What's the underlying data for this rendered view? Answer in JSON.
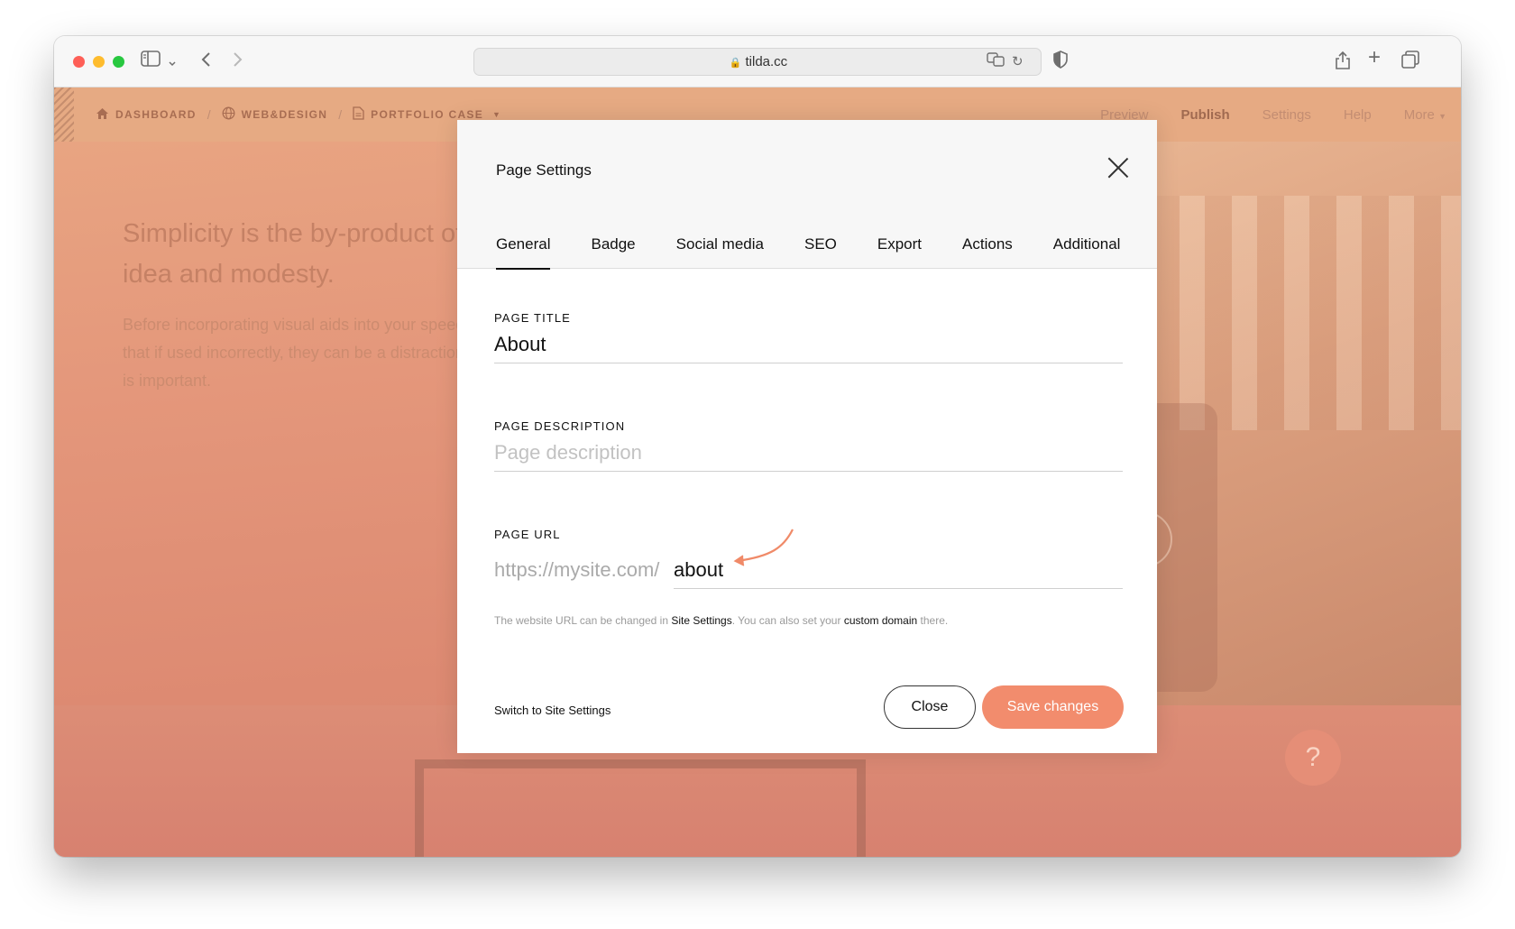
{
  "browser": {
    "url": "tilda.cc"
  },
  "editor": {
    "breadcrumbs": [
      {
        "label": "DASHBOARD",
        "icon": "home-icon"
      },
      {
        "label": "WEB&DESIGN",
        "icon": "globe-icon"
      },
      {
        "label": "PORTFOLIO CASE",
        "icon": "page-icon"
      }
    ],
    "breadcrumb_separator": "/",
    "nav": {
      "preview": "Preview",
      "publish": "Publish",
      "settings": "Settings",
      "help": "Help",
      "more": "More"
    },
    "help_bubble": "?"
  },
  "background_page": {
    "heading": "Simplicity is the by-product of a good idea and modesty.",
    "body": "Before incorporating visual aids into your speech, understand that if used incorrectly, they can be a distraction. Planning ahead is important."
  },
  "modal": {
    "title": "Page Settings",
    "tabs": [
      "General",
      "Badge",
      "Social media",
      "SEO",
      "Export",
      "Actions",
      "Additional"
    ],
    "active_tab": "General",
    "page_title": {
      "label": "PAGE TITLE",
      "value": "About"
    },
    "page_description": {
      "label": "PAGE DESCRIPTION",
      "placeholder": "Page description"
    },
    "page_url": {
      "label": "PAGE URL",
      "prefix": "https://mysite.com/",
      "value": "about"
    },
    "hint": {
      "part1": "The website URL can be changed in ",
      "link1": "Site Settings",
      "part2": ". You can also set your ",
      "link2": "custom domain",
      "part3": " there."
    },
    "switch_link": "Switch to Site Settings",
    "close_button": "Close",
    "save_button": "Save changes"
  },
  "colors": {
    "accent": "#f28c6d",
    "overlay": "#e4977b"
  }
}
